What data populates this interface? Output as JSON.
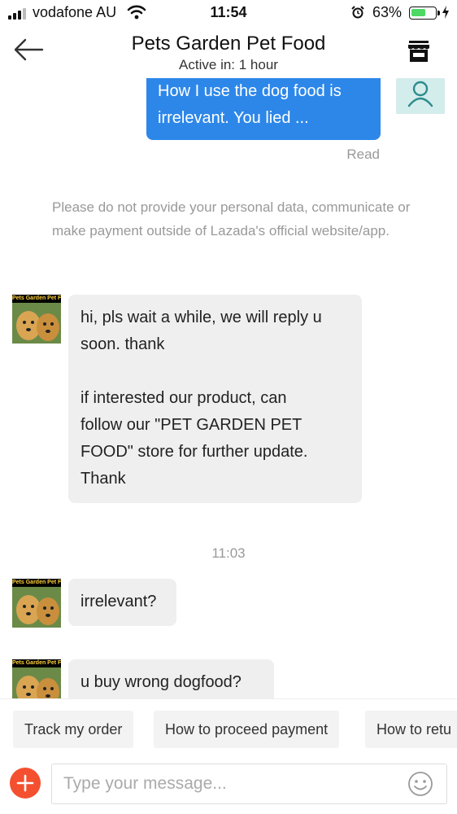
{
  "status_bar": {
    "carrier": "vodafone AU",
    "time": "11:54",
    "battery_percent": "63%",
    "battery_level": 0.63
  },
  "header": {
    "title": "Pets Garden Pet Food",
    "subtitle": "Active in: 1 hour"
  },
  "messages": {
    "outgoing": {
      "line1": "How I use the dog food is",
      "line2": "irrelevant. You lied ...",
      "status": "Read"
    },
    "notice": "Please do not provide your personal data, communicate or make payment outside of Lazada's official website/app.",
    "seller_avatar_label": "Pets Garden Pet Food",
    "incoming_1": {
      "line1": "hi, pls wait a while, we will reply u",
      "line2": "soon. thank",
      "line3": "if interested our product, can",
      "line4": "follow our \"PET GARDEN PET",
      "line5": "FOOD\" store for further update.",
      "line6": "Thank"
    },
    "time_separator": "11:03",
    "incoming_2": "irrelevant?",
    "incoming_3": "u buy wrong dogfood?"
  },
  "quick_replies": [
    "Track my order",
    "How to proceed payment",
    "How to retu"
  ],
  "input": {
    "placeholder": "Type your message..."
  },
  "colors": {
    "outgoing_bubble": "#2d87e9",
    "incoming_bubble": "#efefef",
    "add_button": "#f4502f",
    "battery_fill": "#4cd964"
  }
}
